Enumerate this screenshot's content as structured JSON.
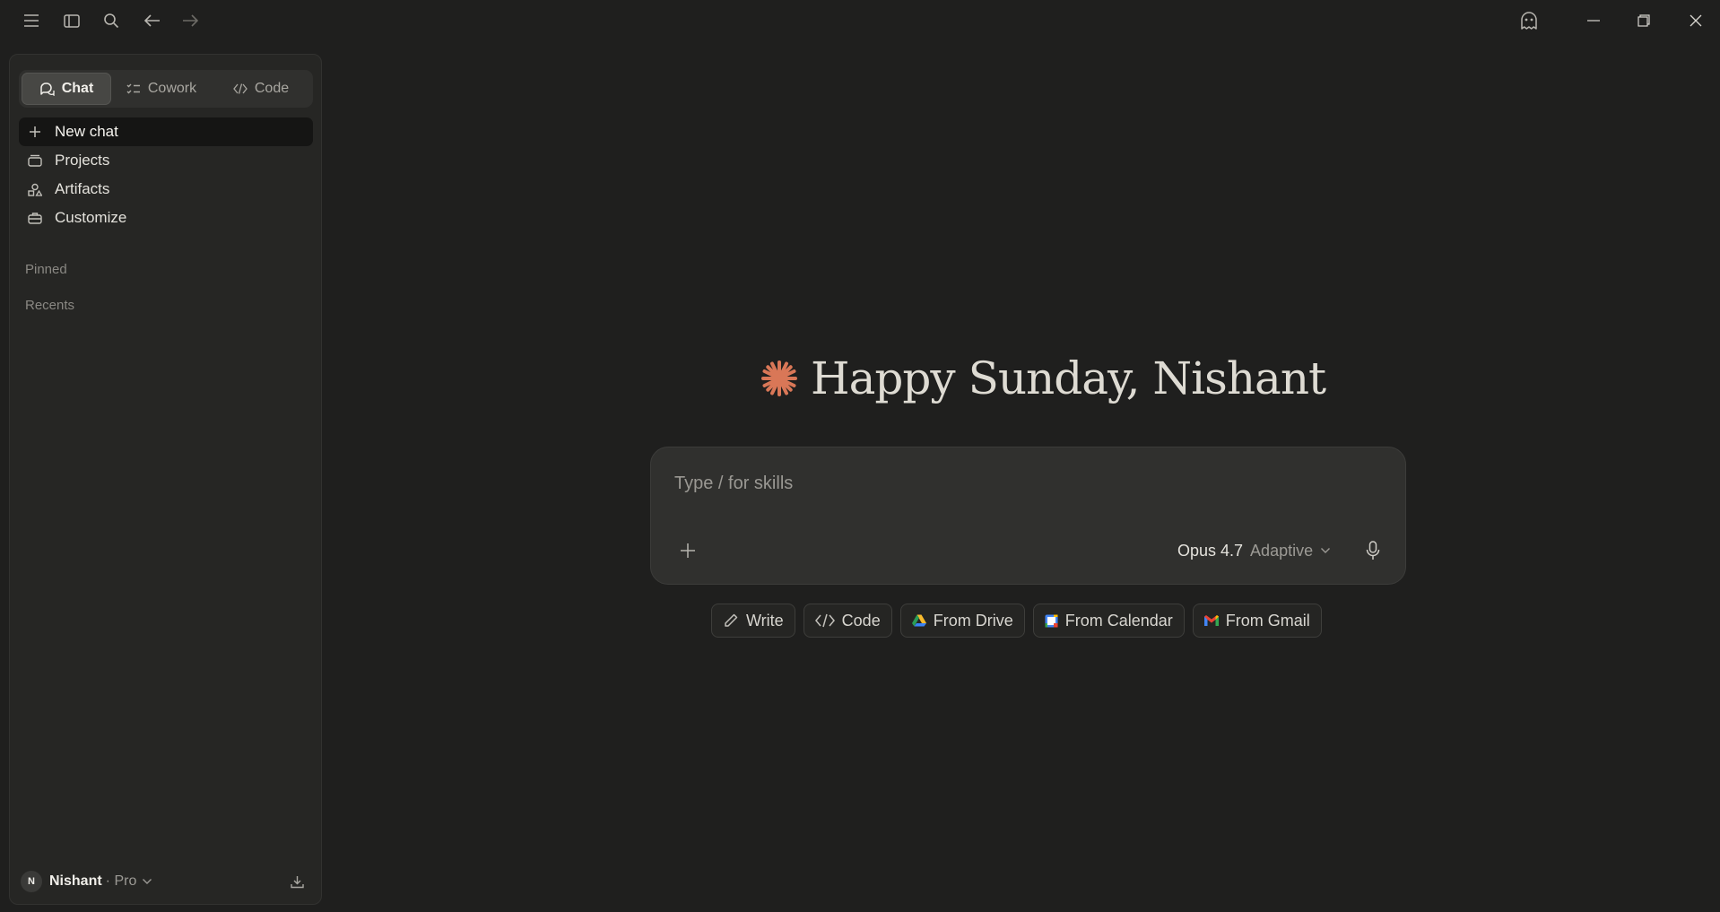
{
  "titlebar": {
    "icons": [
      "menu-icon",
      "sidebar-toggle-icon",
      "search-icon",
      "back-arrow-icon",
      "forward-arrow-icon",
      "ghost-icon"
    ],
    "window_controls": [
      "minimize-icon",
      "restore-icon",
      "close-icon"
    ]
  },
  "sidebar": {
    "modes": [
      {
        "label": "Chat",
        "icon": "chat-bubbles-icon",
        "active": true
      },
      {
        "label": "Cowork",
        "icon": "checklist-icon",
        "active": false
      },
      {
        "label": "Code",
        "icon": "code-brackets-icon",
        "active": false
      }
    ],
    "items": [
      {
        "label": "New chat",
        "icon": "plus-icon",
        "active": true
      },
      {
        "label": "Projects",
        "icon": "folder-stack-icon",
        "active": false
      },
      {
        "label": "Artifacts",
        "icon": "shapes-icon",
        "active": false
      },
      {
        "label": "Customize",
        "icon": "briefcase-icon",
        "active": false
      }
    ],
    "sections": {
      "pinned": "Pinned",
      "recents": "Recents"
    },
    "user": {
      "initial": "N",
      "name": "Nishant",
      "plan": "· Pro"
    }
  },
  "main": {
    "greeting": "Happy Sunday, Nishant",
    "composer": {
      "placeholder": "Type / for skills",
      "model": "Opus 4.7",
      "mode": "Adaptive"
    },
    "chips": [
      {
        "label": "Write",
        "icon": "pencil-icon"
      },
      {
        "label": "Code",
        "icon": "code-brackets-icon"
      },
      {
        "label": "From Drive",
        "icon": "google-drive-icon"
      },
      {
        "label": "From Calendar",
        "icon": "google-calendar-icon"
      },
      {
        "label": "From Gmail",
        "icon": "gmail-icon"
      }
    ]
  },
  "colors": {
    "accent": "#d97757",
    "background": "#1f1f1e",
    "sidebar": "#262624"
  }
}
